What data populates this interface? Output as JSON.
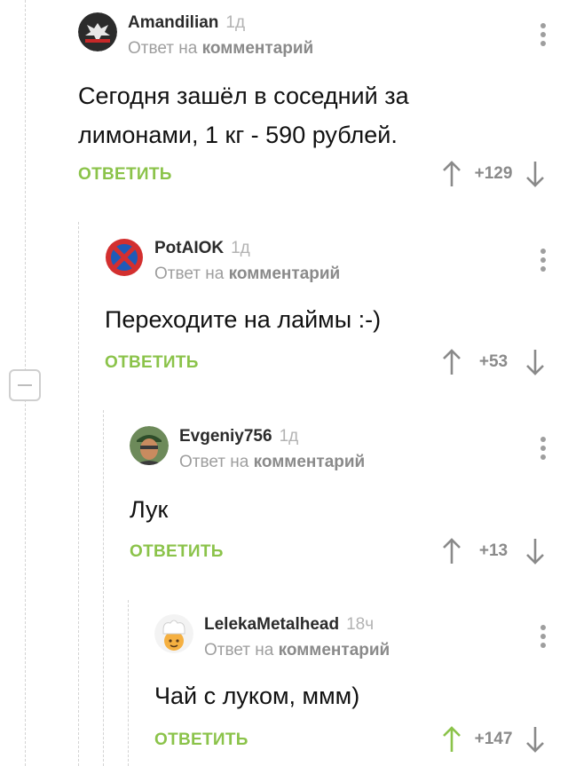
{
  "comments": [
    {
      "username": "Amandilian",
      "time": "1д",
      "reply_prefix": "Ответ на",
      "reply_target": "комментарий",
      "text_lines": [
        "Сегодня зашёл в соседний за",
        "лимонами, 1 кг - 590 рублей."
      ],
      "reply_label": "ОТВЕТИТЬ",
      "score": "+129",
      "voted_up": false,
      "avatar_icon": "eagle-emblem-avatar"
    },
    {
      "username": "PotAIOK",
      "time": "1д",
      "reply_prefix": "Ответ на",
      "reply_target": "комментарий",
      "text_lines": [
        "Переходите на лаймы :-)"
      ],
      "reply_label": "ОТВЕТИТЬ",
      "score": "+53",
      "voted_up": false,
      "avatar_icon": "no-stopping-sign-avatar"
    },
    {
      "username": "Evgeniy756",
      "time": "1д",
      "reply_prefix": "Ответ на",
      "reply_target": "комментарий",
      "text_lines": [
        "Лук"
      ],
      "reply_label": "ОТВЕТИТЬ",
      "score": "+13",
      "voted_up": false,
      "avatar_icon": "person-photo-avatar"
    },
    {
      "username": "LelekaMetalhead",
      "time": "18ч",
      "reply_prefix": "Ответ на",
      "reply_target": "комментарий",
      "text_lines": [
        "Чай с луком, ммм)"
      ],
      "reply_label": "ОТВЕТИТЬ",
      "score": "+147",
      "voted_up": true,
      "avatar_icon": "cook-hat-avatar"
    }
  ],
  "colors": {
    "accent_green": "#8bc34a",
    "gray_text": "#9e9e9e",
    "arrow_gray": "#8a8a8a"
  }
}
